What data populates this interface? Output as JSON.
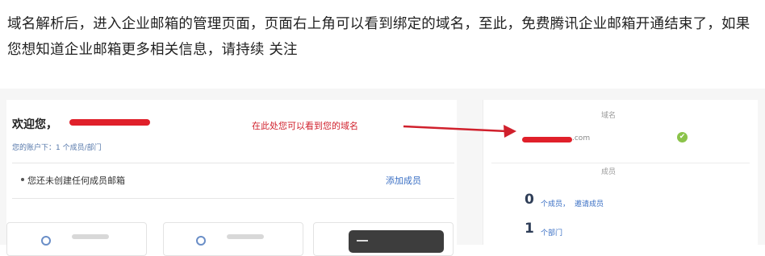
{
  "article": {
    "paragraph": "域名解析后，进入企业邮箱的管理页面，页面右上角可以看到绑定的域名，至此，免费腾讯企业邮箱开通结束了，如果您想知道企业邮箱更多相关信息，请持续 关注"
  },
  "screenshot": {
    "welcome": "欢迎您，",
    "summary": "您的账户下：1 个成员/部门",
    "empty_notice": "您还未创建任何成员邮箱",
    "add_member": "添加成员",
    "annotation": "在此处您可以看到您的域名",
    "domain_title": "域名",
    "domain_suffix": ".com",
    "domain_ok": "✔",
    "members_title": "成员",
    "member_count": "0",
    "member_text": "个成员，",
    "invite_text": "邀请成员",
    "dept_count": "1",
    "dept_text": "个部门",
    "colors": {
      "annotation_red": "#d0202c",
      "check_green": "#8bc34a",
      "link_blue": "#3a6fc4"
    }
  }
}
